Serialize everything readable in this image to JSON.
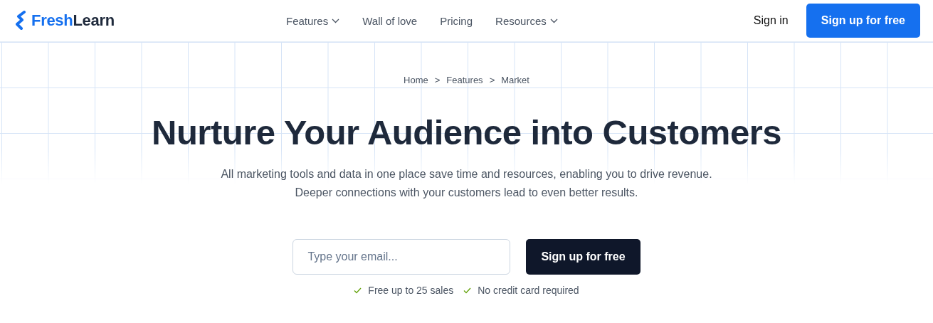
{
  "logo": {
    "first": "Fresh",
    "second": "Learn"
  },
  "nav": [
    {
      "label": "Features",
      "dropdown": true
    },
    {
      "label": "Wall of love",
      "dropdown": false
    },
    {
      "label": "Pricing",
      "dropdown": false
    },
    {
      "label": "Resources",
      "dropdown": true
    }
  ],
  "sign_in": "Sign in",
  "header_cta": "Sign up for free",
  "breadcrumb": {
    "separator": ">",
    "items": [
      "Home",
      "Features",
      "Market"
    ]
  },
  "headline": "Nurture Your Audience into Customers",
  "subtitle": [
    "All marketing tools and data in one place save time and resources, enabling you to drive revenue.",
    "Deeper connections with your customers lead to even better results."
  ],
  "email": {
    "placeholder": "Type your email..."
  },
  "form_cta": "Sign up for free",
  "perks": [
    "Free up to 25 sales",
    "No credit card required"
  ]
}
